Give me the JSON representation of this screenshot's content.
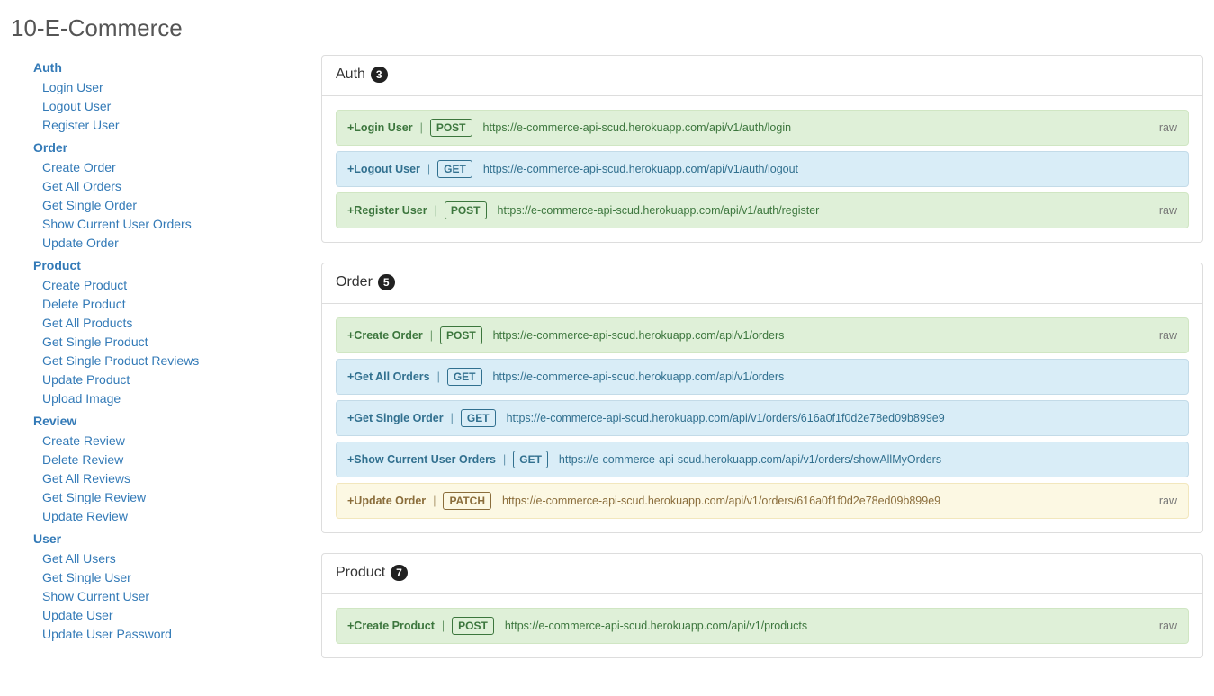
{
  "title": "10-E-Commerce",
  "raw_label": "raw",
  "sidebar": {
    "groups": [
      {
        "name": "Auth",
        "items": [
          "Login User",
          "Logout User",
          "Register User"
        ]
      },
      {
        "name": "Order",
        "items": [
          "Create Order",
          "Get All Orders",
          "Get Single Order",
          "Show Current User Orders",
          "Update Order"
        ]
      },
      {
        "name": "Product",
        "items": [
          "Create Product",
          "Delete Product",
          "Get All Products",
          "Get Single Product",
          "Get Single Product Reviews",
          "Update Product",
          "Upload Image"
        ]
      },
      {
        "name": "Review",
        "items": [
          "Create Review",
          "Delete Review",
          "Get All Reviews",
          "Get Single Review",
          "Update Review"
        ]
      },
      {
        "name": "User",
        "items": [
          "Get All Users",
          "Get Single User",
          "Show Current User",
          "Update User",
          "Update User Password"
        ]
      }
    ]
  },
  "sections": [
    {
      "name": "Auth",
      "count": "3",
      "requests": [
        {
          "name": "Login User",
          "method": "POST",
          "url": "https://e-commerce-api-scud.herokuapp.com/api/v1/auth/login",
          "has_raw": true
        },
        {
          "name": "Logout User",
          "method": "GET",
          "url": "https://e-commerce-api-scud.herokuapp.com/api/v1/auth/logout",
          "has_raw": false
        },
        {
          "name": "Register User",
          "method": "POST",
          "url": "https://e-commerce-api-scud.herokuapp.com/api/v1/auth/register",
          "has_raw": true
        }
      ]
    },
    {
      "name": "Order",
      "count": "5",
      "requests": [
        {
          "name": "Create Order",
          "method": "POST",
          "url": "https://e-commerce-api-scud.herokuapp.com/api/v1/orders",
          "has_raw": true
        },
        {
          "name": "Get All Orders",
          "method": "GET",
          "url": "https://e-commerce-api-scud.herokuapp.com/api/v1/orders",
          "has_raw": false
        },
        {
          "name": "Get Single Order",
          "method": "GET",
          "url": "https://e-commerce-api-scud.herokuapp.com/api/v1/orders/616a0f1f0d2e78ed09b899e9",
          "has_raw": false
        },
        {
          "name": "Show Current User Orders",
          "method": "GET",
          "url": "https://e-commerce-api-scud.herokuapp.com/api/v1/orders/showAllMyOrders",
          "has_raw": false
        },
        {
          "name": "Update Order",
          "method": "PATCH",
          "url": "https://e-commerce-api-scud.herokuapp.com/api/v1/orders/616a0f1f0d2e78ed09b899e9",
          "has_raw": true
        }
      ]
    },
    {
      "name": "Product",
      "count": "7",
      "requests": [
        {
          "name": "Create Product",
          "method": "POST",
          "url": "https://e-commerce-api-scud.herokuapp.com/api/v1/products",
          "has_raw": true
        }
      ]
    }
  ]
}
